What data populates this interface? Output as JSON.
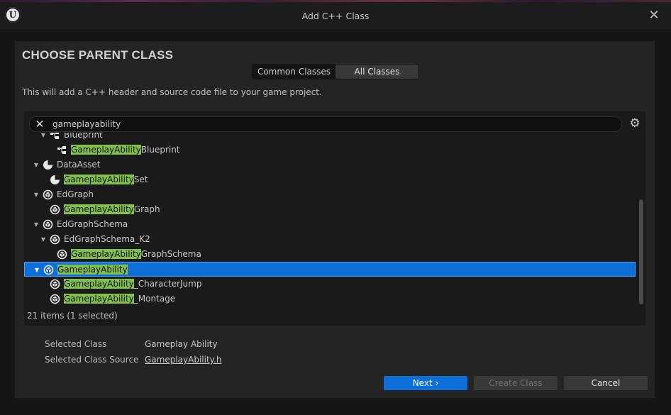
{
  "window": {
    "title": "Add C++ Class"
  },
  "heading": "CHOOSE PARENT CLASS",
  "tabs": [
    "Common Classes",
    "All Classes"
  ],
  "active_tab": "All Classes",
  "description": "This will add a C++ header and source code file to your game project.",
  "search": {
    "value": "gameplayability"
  },
  "tree": {
    "rows": [
      {
        "match": "",
        "rest": "Blueprint",
        "icon": "blueprint-icon",
        "indent": 1,
        "expanded": true,
        "selected": false
      },
      {
        "match": "GameplayAbility",
        "rest": "Blueprint",
        "icon": "blueprint-icon",
        "indent": 2,
        "expanded": false,
        "selected": false
      },
      {
        "match": "",
        "rest": "DataAsset",
        "icon": "pie-icon",
        "indent": 0,
        "expanded": true,
        "selected": false
      },
      {
        "match": "GameplayAbility",
        "rest": "Set",
        "icon": "pie-icon",
        "indent": 1,
        "expanded": false,
        "selected": false
      },
      {
        "match": "",
        "rest": "EdGraph",
        "icon": "object-icon",
        "indent": 0,
        "expanded": true,
        "selected": false
      },
      {
        "match": "GameplayAbility",
        "rest": "Graph",
        "icon": "object-icon",
        "indent": 1,
        "expanded": false,
        "selected": false
      },
      {
        "match": "",
        "rest": "EdGraphSchema",
        "icon": "object-icon",
        "indent": 0,
        "expanded": true,
        "selected": false
      },
      {
        "match": "",
        "rest": "EdGraphSchema_K2",
        "icon": "object-icon",
        "indent": 1,
        "expanded": true,
        "selected": false
      },
      {
        "match": "GameplayAbility",
        "rest": "GraphSchema",
        "icon": "object-icon",
        "indent": 2,
        "expanded": false,
        "selected": false
      },
      {
        "match": "GameplayAbility",
        "rest": "",
        "icon": "object-icon",
        "indent": 0,
        "expanded": true,
        "selected": true
      },
      {
        "match": "GameplayAbility",
        "rest": "_CharacterJump",
        "icon": "object-icon",
        "indent": 1,
        "expanded": false,
        "selected": false
      },
      {
        "match": "GameplayAbility",
        "rest": "_Montage",
        "icon": "object-icon",
        "indent": 1,
        "expanded": false,
        "selected": false
      }
    ],
    "scroll_fraction": 0.6
  },
  "status": {
    "count": "21 items (1 selected)"
  },
  "details": {
    "selected_class_label": "Selected Class",
    "selected_class_value": "Gameplay Ability",
    "selected_source_label": "Selected Class Source",
    "selected_source_value": "GameplayAbility.h"
  },
  "buttons": {
    "next": "Next",
    "create": "Create Class",
    "cancel": "Cancel"
  }
}
